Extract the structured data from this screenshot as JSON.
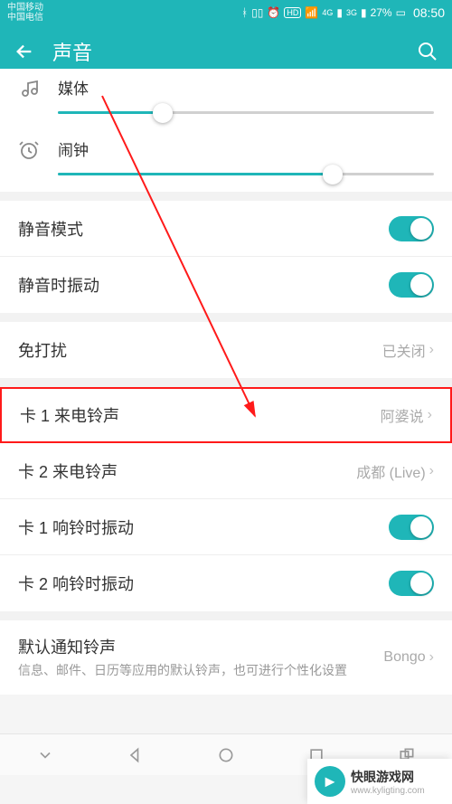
{
  "statusbar": {
    "carrier1": "中国移动",
    "carrier2": "中国电信",
    "battery": "27%",
    "time": "08:50"
  },
  "header": {
    "title": "声音"
  },
  "sliders": {
    "media": {
      "label": "媒体",
      "percent": 28
    },
    "alarm": {
      "label": "闹钟",
      "percent": 73
    }
  },
  "rows": {
    "silent_mode": {
      "label": "静音模式",
      "on": true
    },
    "vibrate_on_silent": {
      "label": "静音时振动",
      "on": true
    },
    "dnd": {
      "label": "免打扰",
      "value": "已关闭"
    },
    "sim1_ringtone": {
      "label": "卡 1 来电铃声",
      "value": "阿婆说"
    },
    "sim2_ringtone": {
      "label": "卡 2 来电铃声",
      "value": "成都 (Live)"
    },
    "sim1_vibrate_ring": {
      "label": "卡 1 响铃时振动",
      "on": true
    },
    "sim2_vibrate_ring": {
      "label": "卡 2 响铃时振动",
      "on": true
    },
    "default_notification": {
      "label": "默认通知铃声",
      "sub": "信息、邮件、日历等应用的默认铃声，也可进行个性化设置",
      "value": "Bongo"
    }
  },
  "watermark": {
    "title": "快眼游戏网",
    "url": "www.kyligting.com"
  }
}
